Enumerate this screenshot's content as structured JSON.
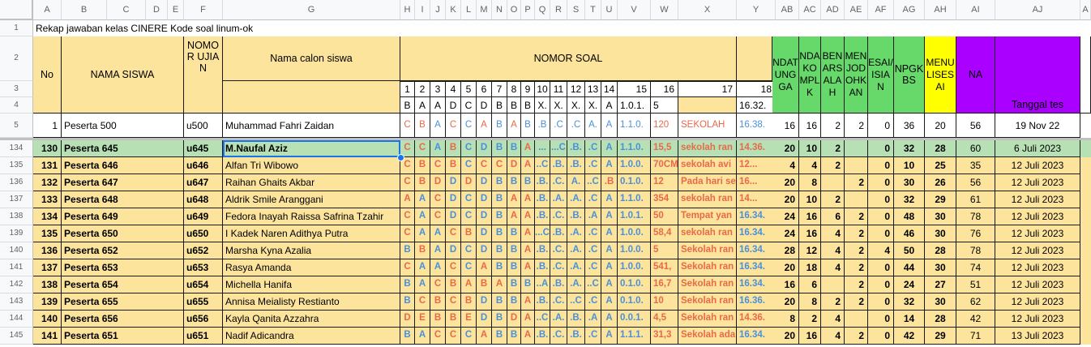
{
  "columns": [
    "A",
    "B",
    "C",
    "D",
    "E",
    "F",
    "G",
    "H",
    "I",
    "J",
    "K",
    "L",
    "M",
    "N",
    "O",
    "P",
    "Q",
    "R",
    "S",
    "T",
    "U",
    "V",
    "W",
    "X",
    "Y",
    "AB",
    "AC",
    "AD",
    "AE",
    "AF",
    "AG",
    "AH",
    "AI",
    "AJ",
    "A"
  ],
  "title": "Rekap jawaban kelas CINERE Kode soal linum-ok",
  "headers": {
    "no": "No",
    "nama_siswa": "NAMA SISWA",
    "nomor_ujian": "NOMOR UJIAN",
    "nama_calon": "Nama calon siswa",
    "nomor_soal": "NOMOR SOAL",
    "nd_atunggal": "NDATUNGGA",
    "ndakomplek": "NDAKOMPLK",
    "benar_salah": "BENARSALAH",
    "menjodohkan": "MENJODOHKAN",
    "esai_isian": "ESAI/ISIAN",
    "npgkbs": "NPGKBS",
    "menulis_esai": "MENULISESAI",
    "na": "NA",
    "tanggal_tes": "Tanggal tes"
  },
  "question_numbers": [
    "1",
    "2",
    "3",
    "4",
    "5",
    "6",
    "7",
    "8",
    "9",
    "10",
    "11",
    "12",
    "13",
    "14",
    "15",
    "16",
    "17",
    "18"
  ],
  "key_row": [
    "B",
    "A",
    "A",
    "D",
    "C",
    "D",
    "B",
    "B",
    "B",
    "X.",
    "X.",
    "X.",
    "X.",
    "A",
    "1.0.1.",
    "5",
    "",
    "16.32."
  ],
  "sample": {
    "row": "5",
    "no": "1",
    "nama": "Peserta 500",
    "nomor": "u500",
    "calon": "Muhammad Fahri Zaidan",
    "answers": [
      "C",
      "B",
      "A",
      "C",
      "C",
      "A",
      "B",
      "A",
      "B",
      ".B",
      ".C",
      ".C",
      "A.",
      "A",
      "1.1.0.",
      "120",
      "SEKOLAH",
      "16.38."
    ],
    "scores": [
      "16",
      "16",
      "2",
      "2",
      "0",
      "36",
      "20",
      "56"
    ],
    "tanggal": "19 Nov 22"
  },
  "rows": [
    {
      "row": "134",
      "no": "130",
      "nama": "Peserta 645",
      "nomor": "u645",
      "calon": "M.Naufal Aziz",
      "answers": [
        "C",
        "C",
        "A",
        "B",
        "C",
        "D",
        "B",
        "B",
        "A",
        "...",
        "...C",
        ".B.",
        ".C",
        "A",
        "1.1.0.",
        "15,5",
        "sekolah ran",
        "14.36."
      ],
      "scores": [
        "20",
        "10",
        "2",
        "",
        "0",
        "32",
        "28",
        "60"
      ],
      "tanggal": "6 Juli 2023"
    },
    {
      "row": "135",
      "no": "131",
      "nama": "Peserta 646",
      "nomor": "u646",
      "calon": "Alfan Tri Wibowo",
      "answers": [
        "C",
        "B",
        "C",
        "B",
        "C",
        "C",
        "C",
        "D",
        "A",
        "..C",
        ".B.",
        ".B.",
        ".C",
        "A",
        "1.0.0.",
        "70CM",
        "sekolah avi",
        "12..."
      ],
      "scores": [
        "4",
        "4",
        "2",
        "",
        "0",
        "10",
        "25",
        "35"
      ],
      "tanggal": "12 Juli 2023"
    },
    {
      "row": "136",
      "no": "132",
      "nama": "Peserta 647",
      "nomor": "u647",
      "calon": "Raihan Ghaits Akbar",
      "answers": [
        "C",
        "B",
        "D",
        "D",
        "D",
        "D",
        "B",
        "B",
        "B",
        ".B.",
        ".C.",
        "A.",
        "..C",
        ".B",
        "0.1.0.",
        "12",
        "Pada hari se",
        "16..."
      ],
      "scores": [
        "20",
        "8",
        "",
        "2",
        "0",
        "30",
        "26",
        "56"
      ],
      "tanggal": "12 Juli 2023"
    },
    {
      "row": "137",
      "no": "133",
      "nama": "Peserta 648",
      "nomor": "u648",
      "calon": "Aldrik Smile Aranggani",
      "answers": [
        "A",
        "A",
        "C",
        "D",
        "C",
        "D",
        "B",
        "A",
        "A",
        ".B.",
        ".A.",
        ".A.",
        ".C",
        "A",
        "1.1.0.",
        "354",
        "sekolah ran",
        "14..."
      ],
      "scores": [
        "20",
        "10",
        "2",
        "",
        "0",
        "32",
        "29",
        "61"
      ],
      "tanggal": "12 Juli 2023"
    },
    {
      "row": "138",
      "no": "134",
      "nama": "Peserta 649",
      "nomor": "u649",
      "calon": "Fedora Inayah Raissa Safrina Tzahir",
      "answers": [
        "C",
        "A",
        "C",
        "D",
        "C",
        "D",
        "B",
        "A",
        "A",
        ".B.",
        ".C.",
        ".B.",
        ".A",
        "A",
        "1.0.1.",
        "50",
        "Tempat yan",
        "16.34."
      ],
      "scores": [
        "24",
        "16",
        "6",
        "2",
        "0",
        "48",
        "30",
        "78"
      ],
      "tanggal": "12 Juli 2023"
    },
    {
      "row": "139",
      "no": "135",
      "nama": "Peserta 650",
      "nomor": "u650",
      "calon": "I Kadek Naren Adithya Putra",
      "answers": [
        "C",
        "A",
        "A",
        "C",
        "B",
        "D",
        "B",
        "B",
        "A",
        "...C",
        ".B.",
        ".A.",
        ".C",
        "A",
        "1.0.0.",
        "58,4",
        "sekolah ran",
        "16.34."
      ],
      "scores": [
        "24",
        "16",
        "4",
        "2",
        "0",
        "46",
        "30",
        "76"
      ],
      "tanggal": "12 Juli 2023"
    },
    {
      "row": "140",
      "no": "136",
      "nama": "Peserta 652",
      "nomor": "u652",
      "calon": "Marsha Kyna Azalia",
      "answers": [
        "B",
        "B",
        "A",
        "D",
        "C",
        "D",
        "B",
        "B",
        "A",
        ".B.",
        ".C.",
        ".A.",
        ".C",
        "A",
        "1.0.0.",
        "5",
        "Sekolah ran",
        "16.34."
      ],
      "scores": [
        "28",
        "12",
        "4",
        "2",
        "4",
        "50",
        "28",
        "78"
      ],
      "tanggal": "12 Juli 2023"
    },
    {
      "row": "141",
      "no": "137",
      "nama": "Peserta 653",
      "nomor": "u653",
      "calon": "Rasya Amanda",
      "answers": [
        "C",
        "A",
        "A",
        "C",
        "C",
        "A",
        "B",
        "B",
        "A",
        ".B.",
        ".C.",
        ".A.",
        ".C",
        "A",
        "1.0.0.",
        "541,",
        "Sekolah ran",
        "16.34."
      ],
      "scores": [
        "20",
        "18",
        "4",
        "2",
        "0",
        "44",
        "30",
        "74"
      ],
      "tanggal": "12 Juli 2023"
    },
    {
      "row": "142",
      "no": "138",
      "nama": "Peserta 654",
      "nomor": "u654",
      "calon": "Michella Hanifa",
      "answers": [
        "B",
        "A",
        "C",
        "B",
        "A",
        "B",
        "A",
        "B",
        "B",
        "..A",
        ".B.",
        ".A.",
        "..C",
        "A",
        "0.1.0.",
        "16,7",
        "Sekolah ran",
        "16.34."
      ],
      "scores": [
        "16",
        "6",
        "",
        "2",
        "0",
        "24",
        "27",
        "51"
      ],
      "tanggal": "12 Juli 2023"
    },
    {
      "row": "143",
      "no": "139",
      "nama": "Peserta 655",
      "nomor": "u655",
      "calon": "Annisa Meialisty Restianto",
      "answers": [
        "B",
        "C",
        "B",
        "C",
        "B",
        "D",
        "B",
        "B",
        "A",
        ".B.",
        ".C.",
        "..C",
        ".C",
        "A",
        "0.1.0.",
        "10",
        "Sekolah ran",
        "16.36."
      ],
      "scores": [
        "20",
        "8",
        "2",
        "2",
        "0",
        "32",
        "30",
        "62"
      ],
      "tanggal": "12 Juli 2023"
    },
    {
      "row": "144",
      "no": "140",
      "nama": "Peserta 656",
      "nomor": "u656",
      "calon": "Kayla Qanita Azzahra",
      "answers": [
        "D",
        "E",
        "B",
        "B",
        "E",
        "D",
        "B",
        "D",
        "A",
        "..C",
        ".A.",
        ".B.",
        ".A",
        "A",
        "0.0.1.",
        "4,5",
        "Sekolah ran",
        "14.36."
      ],
      "scores": [
        "8",
        "2",
        "4",
        "",
        "0",
        "14",
        "28",
        "42"
      ],
      "tanggal": "12 Juli 2023"
    },
    {
      "row": "145",
      "no": "141",
      "nama": "Peserta 651",
      "nomor": "u651",
      "calon": "Nadif Adicandra",
      "answers": [
        "B",
        "A",
        "C",
        "C",
        "C",
        "A",
        "B",
        "B",
        "A",
        ".B.",
        ".C.",
        ".B.",
        ".C",
        "A",
        "1.1.1.",
        "31,3",
        "Sekolah ada",
        "16.34."
      ],
      "scores": [
        "20",
        "16",
        "4",
        "2",
        "0",
        "42",
        "29",
        "71"
      ],
      "tanggal": "13 Juli 2023"
    }
  ]
}
